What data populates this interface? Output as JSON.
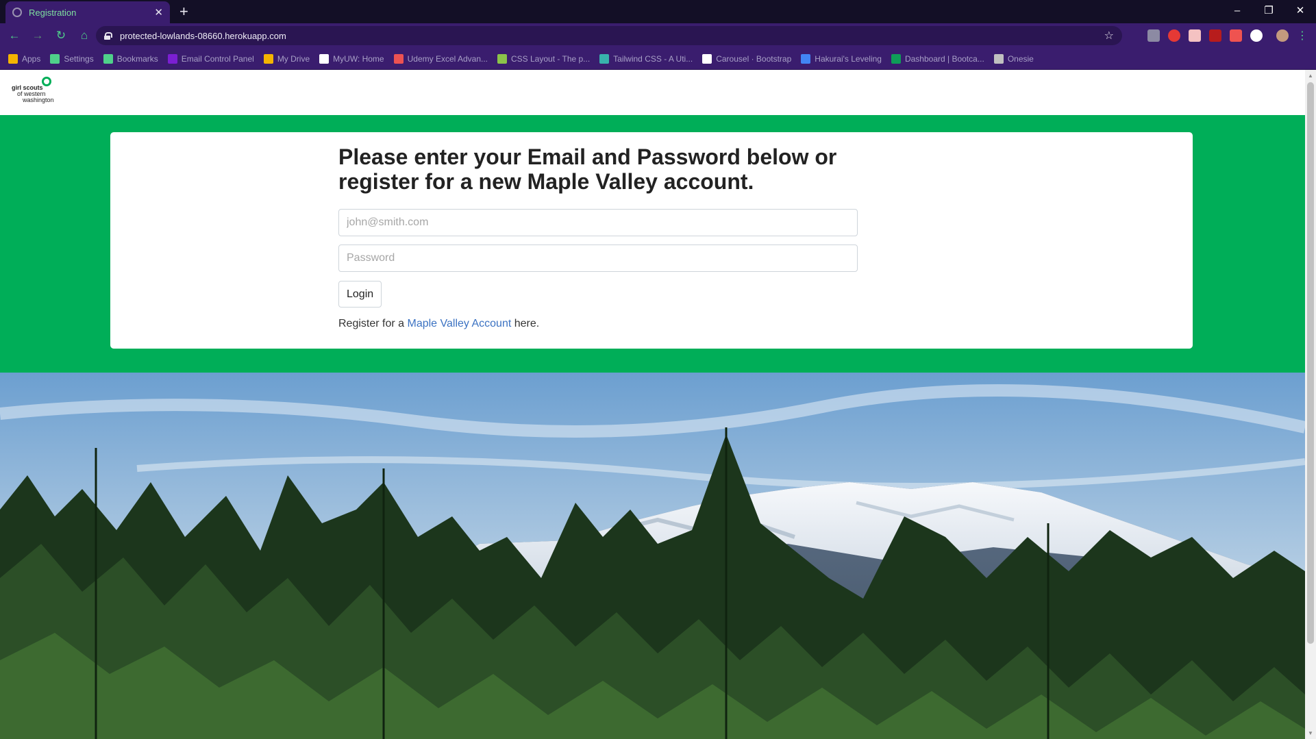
{
  "browser": {
    "tab_title": "Registration",
    "tab_close": "✕",
    "new_tab": "+",
    "url": "protected-lowlands-08660.herokuapp.com",
    "window_controls": [
      "–",
      "❐",
      "✕"
    ]
  },
  "bookmarks": [
    {
      "label": "Apps",
      "icon": "apps-grid-icon",
      "color": "#f4b400"
    },
    {
      "label": "Settings",
      "icon": "gear-icon",
      "color": "#4fd08a"
    },
    {
      "label": "Bookmarks",
      "icon": "star-icon",
      "color": "#4fd08a"
    },
    {
      "label": "Email Control Panel",
      "icon": "yahoo-icon",
      "color": "#7b1fd2"
    },
    {
      "label": "My Drive",
      "icon": "google-drive-icon",
      "color": "#f4b400"
    },
    {
      "label": "MyUW: Home",
      "icon": "myuw-icon",
      "color": "#ffffff"
    },
    {
      "label": "Udemy Excel Advan...",
      "icon": "udemy-icon",
      "color": "#ec5252"
    },
    {
      "label": "CSS Layout - The p...",
      "icon": "css-layout-icon",
      "color": "#8bc34a"
    },
    {
      "label": "Tailwind CSS - A Uti...",
      "icon": "tailwind-icon",
      "color": "#38b2ac"
    },
    {
      "label": "Carousel · Bootstrap",
      "icon": "bootstrap-icon",
      "color": "#ffffff"
    },
    {
      "label": "Hakurai's Leveling",
      "icon": "document-icon",
      "color": "#4285f4"
    },
    {
      "label": "Dashboard | Bootca...",
      "icon": "bootcamp-icon",
      "color": "#0f9d58"
    },
    {
      "label": "Onesie",
      "icon": "onesie-icon",
      "color": "#c0c0c0"
    }
  ],
  "site": {
    "logo": {
      "line1": "girl scouts",
      "line2": "of western",
      "line3": "washington"
    },
    "heading": "Please enter your Email and Password below or register for a new Maple Valley account.",
    "email_placeholder": "john@smith.com",
    "password_placeholder": "Password",
    "login_label": "Login",
    "register_prefix": "Register for a",
    "register_link": "Maple Valley Account",
    "register_suffix": "here."
  },
  "colors": {
    "brand_green": "#00ae58",
    "link_blue": "#3b72c2",
    "browser_purple": "#3a1d6e"
  }
}
